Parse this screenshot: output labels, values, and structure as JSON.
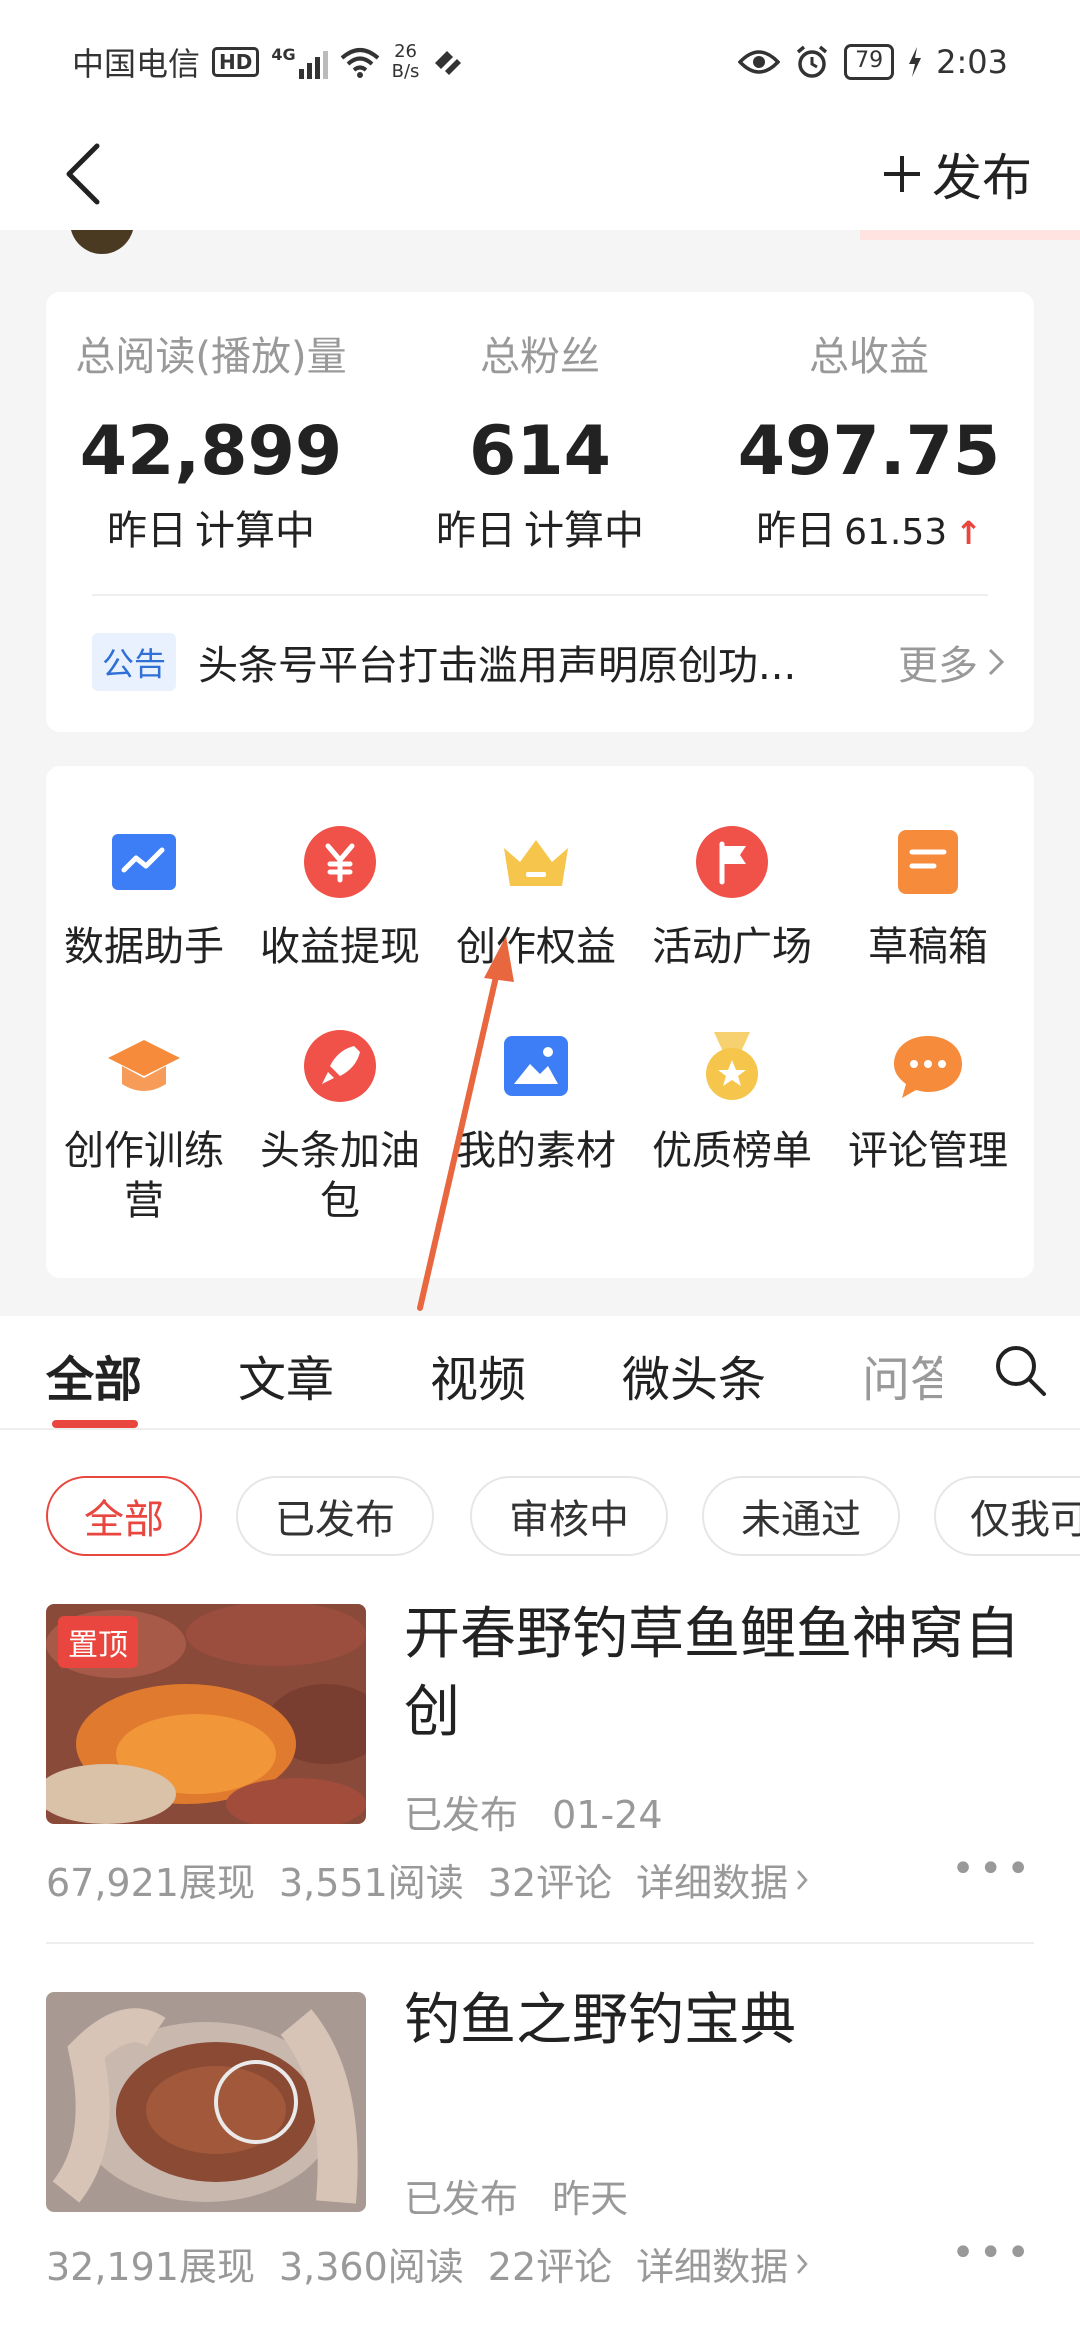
{
  "status_bar": {
    "carrier": "中国电信",
    "hd_badge": "HD",
    "signal_label": "4G",
    "net_speed": "26",
    "net_unit": "B/s",
    "battery": "79",
    "time": "2:03"
  },
  "nav": {
    "publish_label": "发布"
  },
  "stats": [
    {
      "label": "总阅读(播放)量",
      "value": "42,899",
      "sub_prefix": "昨日",
      "sub_value": "计算中",
      "trend": ""
    },
    {
      "label": "总粉丝",
      "value": "614",
      "sub_prefix": "昨日",
      "sub_value": "计算中",
      "trend": ""
    },
    {
      "label": "总收益",
      "value": "497.75",
      "sub_prefix": "昨日",
      "sub_value": "61.53",
      "trend": "↑"
    }
  ],
  "notice": {
    "tag": "公告",
    "text": "头条号平台打击滥用声明原创功...",
    "more": "更多"
  },
  "tools": [
    {
      "label": "数据助手",
      "icon": "chart-icon",
      "color": "#3d7ef6"
    },
    {
      "label": "收益提现",
      "icon": "yuan-icon",
      "color": "#f0524a"
    },
    {
      "label": "创作权益",
      "icon": "crown-icon",
      "color": "#f5c64b"
    },
    {
      "label": "活动广场",
      "icon": "flag-icon",
      "color": "#f0524a"
    },
    {
      "label": "草稿箱",
      "icon": "draft-icon",
      "color": "#f58b3b"
    },
    {
      "label": "创作训练营",
      "label_line1": "创作训练",
      "label_line2": "营",
      "icon": "graduation-cap-icon",
      "color": "#f58b3b"
    },
    {
      "label": "头条加油包",
      "label_line1": "头条加油",
      "label_line2": "包",
      "icon": "rocket-icon",
      "color": "#f0524a"
    },
    {
      "label": "我的素材",
      "icon": "image-icon",
      "color": "#3d7ef6"
    },
    {
      "label": "优质榜单",
      "icon": "medal-icon",
      "color": "#f5c64b"
    },
    {
      "label": "评论管理",
      "icon": "comment-icon",
      "color": "#f58b3b"
    }
  ],
  "tabs": [
    "全部",
    "文章",
    "视频",
    "微头条",
    "问答"
  ],
  "filters": [
    "全部",
    "已发布",
    "审核中",
    "未通过",
    "仅我可见"
  ],
  "articles": [
    {
      "pinned": "置顶",
      "title": "开春野钓草鱼鲤鱼神窝自创",
      "status": "已发布",
      "date": "01-24",
      "impressions": "67,921展现",
      "reads": "3,551阅读",
      "comments": "32评论",
      "detail": "详细数据"
    },
    {
      "pinned": "",
      "title": "钓鱼之野钓宝典",
      "status": "已发布",
      "date": "昨天",
      "impressions": "32,191展现",
      "reads": "3,360阅读",
      "comments": "22评论",
      "detail": "详细数据"
    }
  ],
  "colors": {
    "accent": "#e8463e",
    "link_blue": "#2f6fd6",
    "muted": "#999999"
  }
}
